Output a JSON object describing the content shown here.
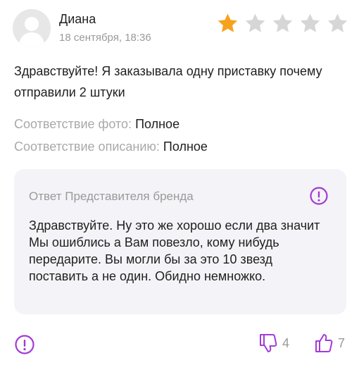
{
  "review": {
    "author_name": "Диана",
    "date": "18 сентября, 18:36",
    "rating": 1,
    "rating_max": 5,
    "text": "Здравствуйте! Я заказывала одну приставку почему отправили 2 штуки",
    "attributes": [
      {
        "label": "Соответствие фото:",
        "value": "Полное"
      },
      {
        "label": "Соответствие описанию:",
        "value": "Полное"
      }
    ]
  },
  "brand_reply": {
    "title": "Ответ Представителя бренда",
    "text": "Здравствуйте. Ну это же хорошо если два значит Мы ошиблись а Вам повезло, кому нибудь передарите. Вы могли бы за это 10 звезд поставить а не один. Обидно немножко."
  },
  "votes": {
    "dislike_count": "4",
    "like_count": "7"
  },
  "colors": {
    "star_active": "#f6a21c",
    "star_inactive": "#d6d6d6",
    "accent": "#a23bd7",
    "reply_background": "#f4f3f7"
  },
  "icons": {
    "avatar": "user-avatar-icon",
    "star": "star-icon",
    "report": "exclamation-circle-icon",
    "dislike": "thumbs-down-icon",
    "like": "thumbs-up-icon"
  }
}
